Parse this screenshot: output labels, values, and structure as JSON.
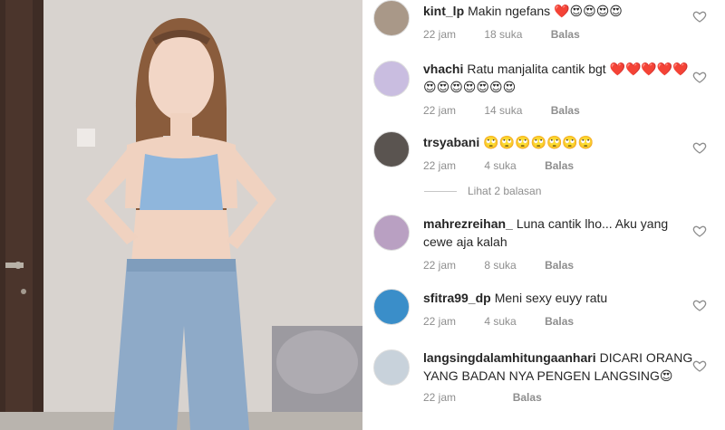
{
  "comments": [
    {
      "username": "kint_lp",
      "text": "Makin ngefans ❤️😍😍😍😍",
      "time": "22 jam",
      "likes": "18 suka",
      "reply": "Balas",
      "avatar_icon": "person-avatar-icon"
    },
    {
      "username": "vhachi",
      "text": "Ratu manjalita cantik bgt ❤️❤️❤️❤️❤️😍😍😍😍😍😍😍",
      "time": "22 jam",
      "likes": "14 suka",
      "reply": "Balas",
      "avatar_icon": "grid-avatar-icon"
    },
    {
      "username": "trsyabani",
      "text": "🙄🙄🙄🙄🙄🙄🙄",
      "time": "22 jam",
      "likes": "4 suka",
      "reply": "Balas",
      "avatar_icon": "person-avatar-icon"
    },
    {
      "username": "mahrezreihan_",
      "text": "Luna cantik lho... Aku yang cewe aja kalah",
      "time": "22 jam",
      "likes": "8 suka",
      "reply": "Balas",
      "avatar_icon": "person-avatar-icon"
    },
    {
      "username": "sfitra99_dp",
      "text": "Meni sexy euyy ratu",
      "time": "22 jam",
      "likes": "4 suka",
      "reply": "Balas",
      "avatar_icon": "person-avatar-icon"
    },
    {
      "username": "langsingdalamhitungaanhari",
      "text": "DICARI ORANG YANG BADAN NYA PENGEN LANGSING😍",
      "time": "22 jam",
      "likes": "",
      "reply": "Balas",
      "avatar_icon": "person-avatar-icon"
    }
  ],
  "view_replies": "Lihat 2 balasan",
  "colors": {
    "text": "#262626",
    "muted": "#8e8e8e",
    "heart_outline": "#8e8e8e"
  }
}
